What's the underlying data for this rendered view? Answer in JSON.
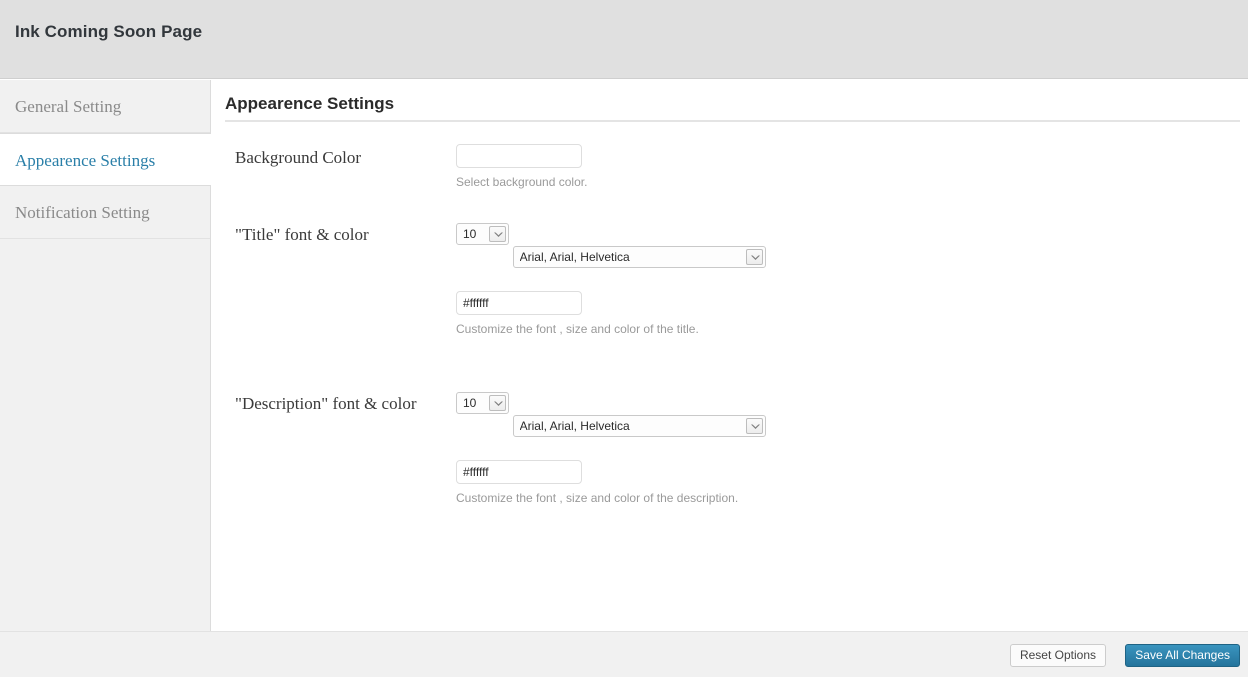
{
  "header": {
    "title": "Ink Coming Soon Page"
  },
  "sidebar": {
    "items": [
      {
        "label": "General Setting",
        "active": false
      },
      {
        "label": "Appearence Settings",
        "active": true
      },
      {
        "label": "Notification Setting",
        "active": false
      }
    ]
  },
  "main": {
    "heading": "Appearence Settings",
    "fields": [
      {
        "label": "Background Color",
        "hint": "Select background color.",
        "color_value": "",
        "color_placeholder": ""
      },
      {
        "label": "\"Title\" font & color",
        "hint": "Customize the font , size and color of the title.",
        "size_value": "10",
        "font_value": "Arial, Arial, Helvetica",
        "color_value": "#ffffff"
      },
      {
        "label": "\"Description\" font & color",
        "hint": "Customize the font , size and color of the description.",
        "size_value": "10",
        "font_value": "Arial, Arial, Helvetica",
        "color_value": "#ffffff"
      }
    ]
  },
  "footer": {
    "reset_label": "Reset Options",
    "save_label": "Save All Changes"
  },
  "colors": {
    "accent": "#2a7fa8",
    "header_bg": "#e0e0e0",
    "sidebar_bg": "#f1f1f1",
    "hint_text": "#9a9a9a"
  }
}
